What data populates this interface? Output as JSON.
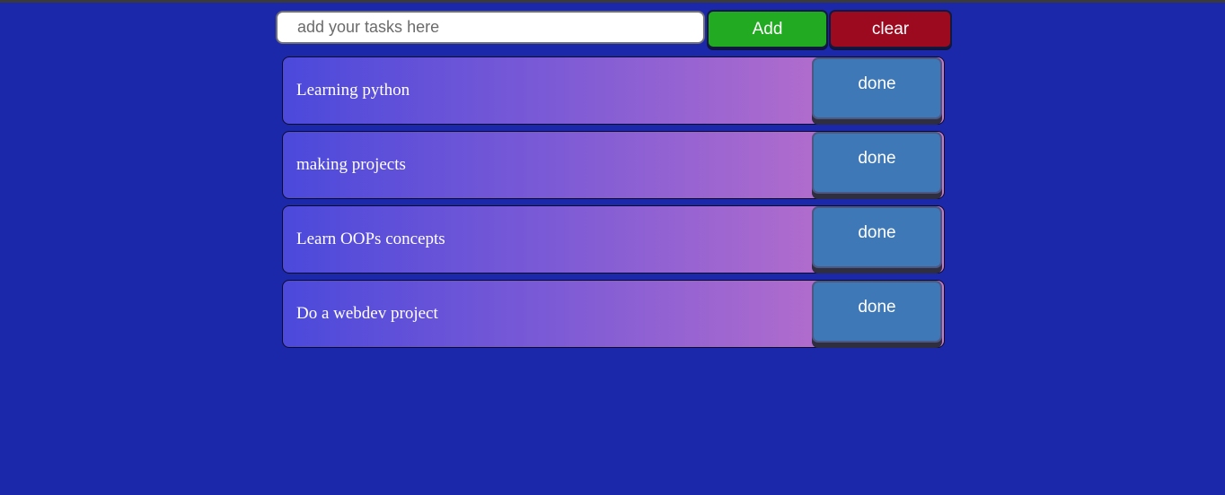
{
  "input": {
    "placeholder": "add your tasks here",
    "value": ""
  },
  "buttons": {
    "add_label": "Add",
    "clear_label": "clear"
  },
  "tasks": [
    {
      "text": "Learning python",
      "done_label": "done"
    },
    {
      "text": "making projects",
      "done_label": "done"
    },
    {
      "text": "Learn OOPs concepts",
      "done_label": "done"
    },
    {
      "text": "Do a webdev project",
      "done_label": "done"
    }
  ],
  "colors": {
    "background": "#1b28aa",
    "add_button": "#22aa22",
    "clear_button": "#9c0a20",
    "done_button": "#3f78b6",
    "task_gradient_start": "#4b49db",
    "task_gradient_end": "#c779c9"
  }
}
